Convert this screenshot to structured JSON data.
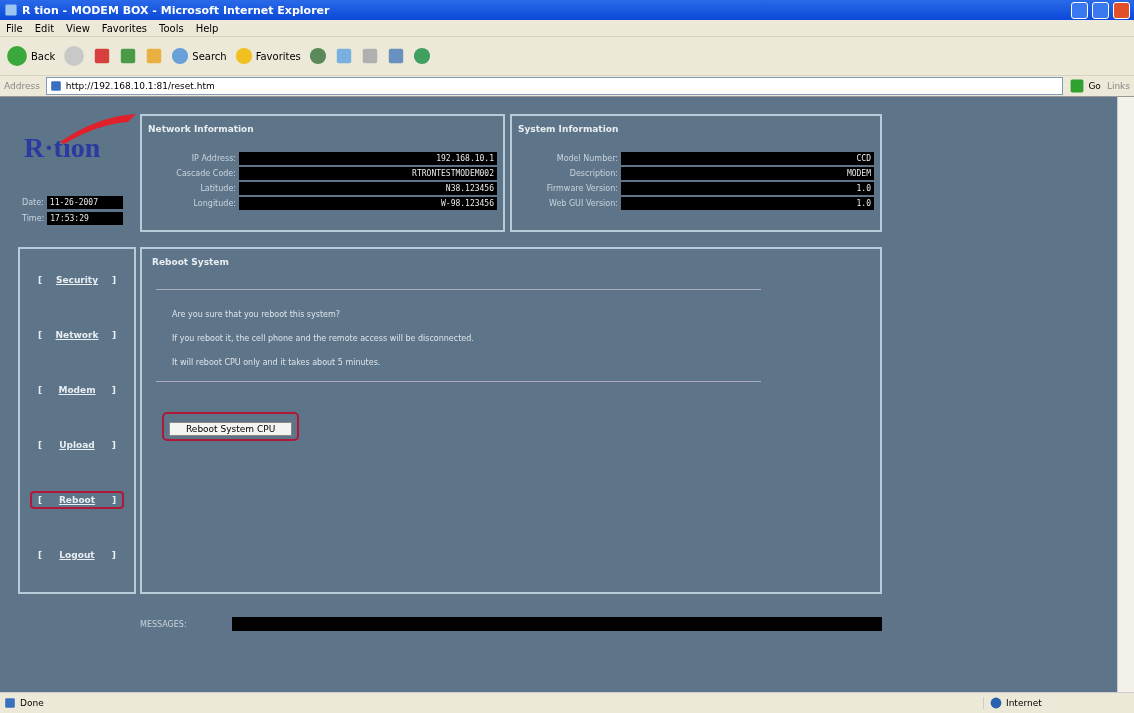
{
  "window": {
    "title": "R tion - MODEM BOX - Microsoft Internet Explorer"
  },
  "menu": [
    "File",
    "Edit",
    "View",
    "Favorites",
    "Tools",
    "Help"
  ],
  "toolbar": {
    "back": "Back",
    "search": "Search",
    "favorites": "Favorites"
  },
  "address": {
    "label": "Address",
    "url": "http://192.168.10.1:81/reset.htm",
    "go": "Go",
    "links": "Links"
  },
  "logo": {
    "text": "R·tion"
  },
  "clock": [
    {
      "label": "Date:",
      "value": "11-26-2007"
    },
    {
      "label": "Time:",
      "value": "17:53:29"
    }
  ],
  "network_info": {
    "title": "Network Information",
    "fields": [
      {
        "label": "IP Address:",
        "value": "192.168.10.1"
      },
      {
        "label": "Cascade Code:",
        "value": "RTRONTESTMODEM002"
      },
      {
        "label": "Latitude:",
        "value": "N38.123456"
      },
      {
        "label": "Longitude:",
        "value": "W-98.123456"
      }
    ]
  },
  "system_info": {
    "title": "System Information",
    "fields": [
      {
        "label": "Model Number:",
        "value": "CCD"
      },
      {
        "label": "Description:",
        "value": "MODEM"
      },
      {
        "label": "Firmware Version:",
        "value": "1.0"
      },
      {
        "label": "Web GUI Version:",
        "value": "1.0"
      }
    ]
  },
  "sidebar": {
    "items": [
      {
        "open": "[",
        "label": "Security",
        "close": "]",
        "selected": false
      },
      {
        "open": "[",
        "label": "Network",
        "close": "]",
        "selected": false
      },
      {
        "open": "[",
        "label": "Modem",
        "close": "]",
        "selected": false
      },
      {
        "open": "[",
        "label": "Upload",
        "close": "]",
        "selected": false
      },
      {
        "open": "[",
        "label": "Reboot",
        "close": "]",
        "selected": true
      },
      {
        "open": "[",
        "label": "Logout",
        "close": "]",
        "selected": false
      }
    ]
  },
  "panel": {
    "title": "Reboot System",
    "lines": [
      "Are you sure that you reboot this system?",
      "If you reboot it, the cell phone and the remote access will be disconnected.",
      "It will reboot CPU only and it takes about 5 minutes."
    ],
    "button": {
      "label": "Reboot System CPU",
      "highlighted": true
    }
  },
  "messages": {
    "label": "MESSAGES:"
  },
  "status_bar": {
    "text": "Done",
    "zone": "Internet"
  }
}
